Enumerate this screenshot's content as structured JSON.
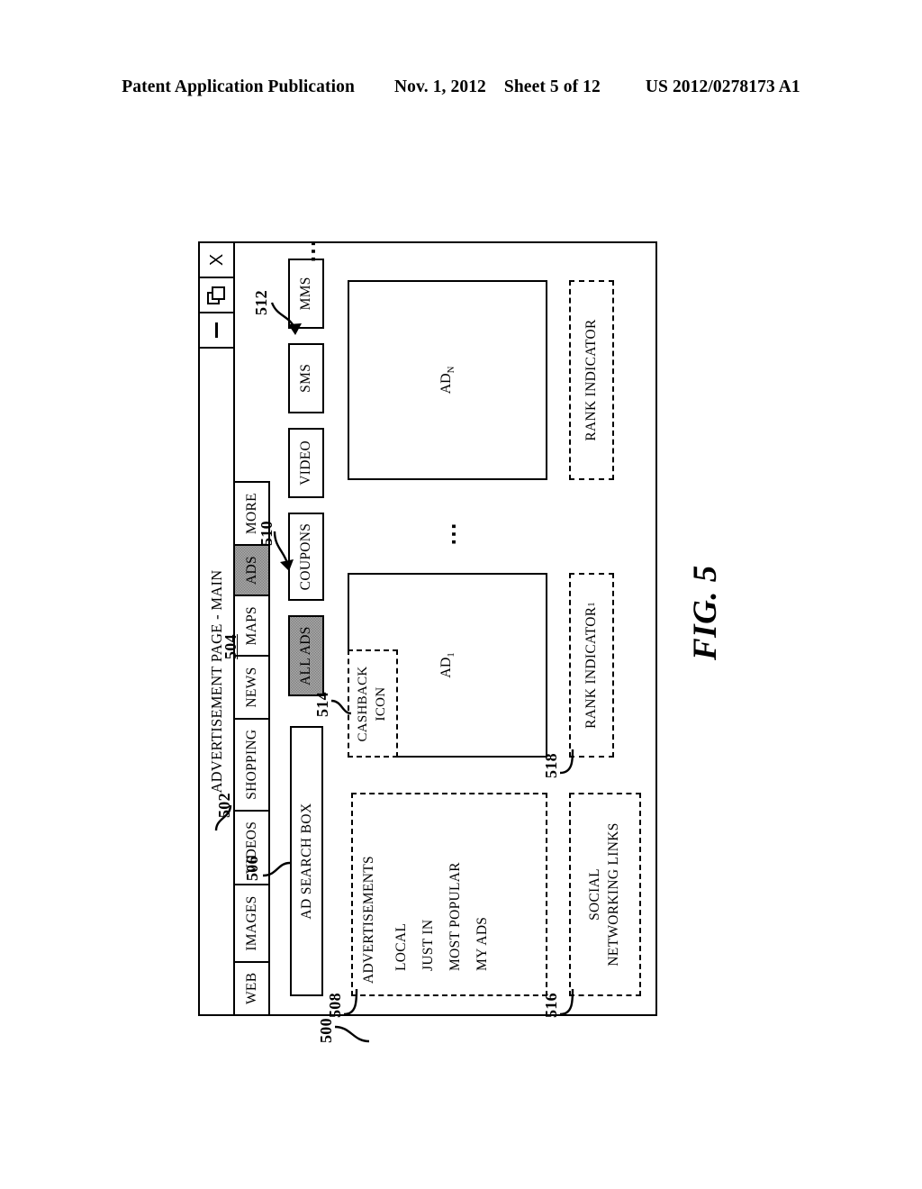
{
  "publication_header": {
    "left": "Patent Application Publication",
    "date": "Nov. 1, 2012",
    "sheet": "Sheet 5 of 12",
    "patent_number": "US 2012/0278173 A1"
  },
  "figure": {
    "label": "FIG. 5",
    "reference_numerals": {
      "window": "500",
      "selected_tab": "502",
      "page_region": "504",
      "search_box": "506",
      "ads_panel": "508",
      "subnav_strip": "510",
      "ad_n_block": "512",
      "cashback_icon": "514",
      "social_links": "516",
      "rank_indicator_1": "518"
    }
  },
  "window": {
    "title": "ADVERTISEMENT PAGE - MAIN",
    "controls": [
      {
        "name": "minimize-button",
        "icon": "minimize-icon",
        "label": "—"
      },
      {
        "name": "restore-button",
        "icon": "restore-icon",
        "label": ""
      },
      {
        "name": "close-button",
        "icon": "close-icon",
        "label": "X"
      }
    ]
  },
  "tabs": [
    {
      "label": "WEB",
      "selected": false
    },
    {
      "label": "IMAGES",
      "selected": false
    },
    {
      "label": "VIDEOS",
      "selected": false
    },
    {
      "label": "SHOPPING",
      "selected": false
    },
    {
      "label": "NEWS",
      "selected": false
    },
    {
      "label": "MAPS",
      "selected": false
    },
    {
      "label": "ADS",
      "selected": true
    },
    {
      "label": "MORE",
      "selected": false
    }
  ],
  "search": {
    "label": "AD SEARCH BOX",
    "placeholder": "AD SEARCH BOX"
  },
  "subnav": {
    "ellipsis": "⋯",
    "items": [
      {
        "label": "ALL ADS",
        "selected": true
      },
      {
        "label": "COUPONS",
        "selected": false
      },
      {
        "label": "VIDEO",
        "selected": false
      },
      {
        "label": "SMS",
        "selected": false
      },
      {
        "label": "MMS",
        "selected": false
      }
    ]
  },
  "ads_panel": {
    "title": "ADVERTISEMENTS",
    "items": [
      {
        "label": "LOCAL"
      },
      {
        "label": "JUST IN"
      },
      {
        "label": "MOST POPULAR"
      },
      {
        "label": "MY ADS"
      }
    ]
  },
  "social_links": {
    "line1": "SOCIAL",
    "line2": "NETWORKING LINKS"
  },
  "ads": {
    "ellipsis": "⋯",
    "first": {
      "label_text": "AD",
      "label_sub": "1",
      "cashback": {
        "line1": "CASHBACK",
        "line2": "ICON"
      },
      "rank_text": "RANK INDICATOR",
      "rank_sub": "1"
    },
    "last": {
      "label_text": "AD",
      "label_sub": "N",
      "rank_text": "RANK INDICATOR",
      "rank_sub": ""
    }
  },
  "colors": {
    "ink": "#000000",
    "paper": "#ffffff",
    "selected_fill": "#c8c8c8"
  }
}
